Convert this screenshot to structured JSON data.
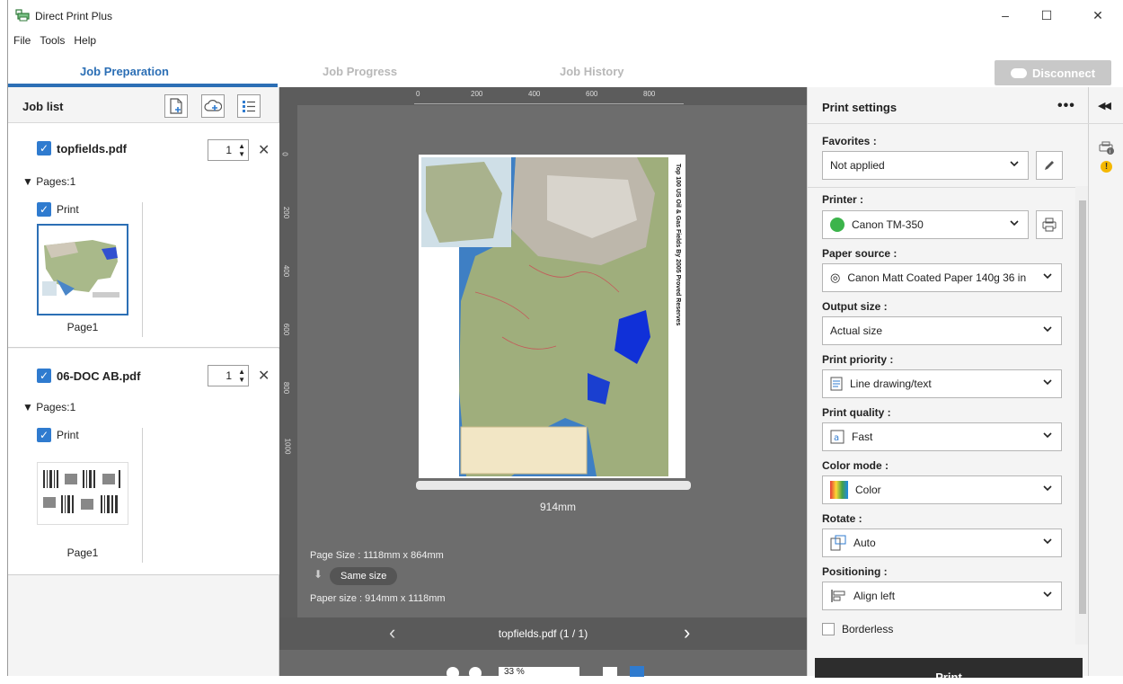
{
  "window": {
    "title": "Direct Print Plus",
    "minimize": "–",
    "maximize": "☐",
    "close": "✕"
  },
  "menu": [
    "File",
    "Tools",
    "Help"
  ],
  "tabs": [
    {
      "label": "Job Preparation",
      "active": true
    },
    {
      "label": "Job Progress",
      "active": false
    },
    {
      "label": "Job History",
      "active": false
    }
  ],
  "disconnect_label": "Disconnect",
  "job_list": {
    "title": "Job list",
    "jobs": [
      {
        "name": "topfields.pdf",
        "copies": "1",
        "pages_label": "Pages:1",
        "print_label": "Print",
        "page_label": "Page1"
      },
      {
        "name": "06-DOC AB.pdf",
        "copies": "1",
        "pages_label": "Pages:1",
        "print_label": "Print",
        "page_label": "Page1"
      }
    ]
  },
  "preview": {
    "ruler_top": [
      "0",
      "200",
      "400",
      "600",
      "800"
    ],
    "ruler_left": [
      "0",
      "200",
      "400",
      "600",
      "800",
      "1000"
    ],
    "poster_title": "Top 100 US Oil & Gas Fields By 2005 Proved Reserves",
    "width_label": "914mm",
    "page_size": "Page Size : 1118mm x 864mm",
    "same_size": "Same size",
    "paper_size": "Paper size : 914mm x 1118mm",
    "nav_label": "topfields.pdf (1 / 1)",
    "zoom_value": "33 %"
  },
  "print_settings": {
    "title": "Print settings",
    "more": "•••",
    "favorites": {
      "label": "Favorites  :",
      "value": "Not applied"
    },
    "printer": {
      "label": "Printer  :",
      "value": "Canon TM-350",
      "status_color": "#3cb44b"
    },
    "paper_source": {
      "label": "Paper source  :",
      "value": "Canon Matt Coated Paper 140g 36 in"
    },
    "output_size": {
      "label": "Output size  :",
      "value": "Actual size"
    },
    "print_priority": {
      "label": "Print priority  :",
      "value": "Line drawing/text"
    },
    "print_quality": {
      "label": "Print quality  :",
      "value": "Fast"
    },
    "color_mode": {
      "label": "Color mode  :",
      "value": "Color"
    },
    "rotate": {
      "label": "Rotate  :",
      "value": "Auto"
    },
    "positioning": {
      "label": "Positioning  :",
      "value": "Align left"
    },
    "borderless": "Borderless",
    "print_button": "Print"
  },
  "colors": {
    "accent": "#2c6fb5",
    "checkbox": "#2f7bcf",
    "preview_bg": "#6d6d6d"
  }
}
